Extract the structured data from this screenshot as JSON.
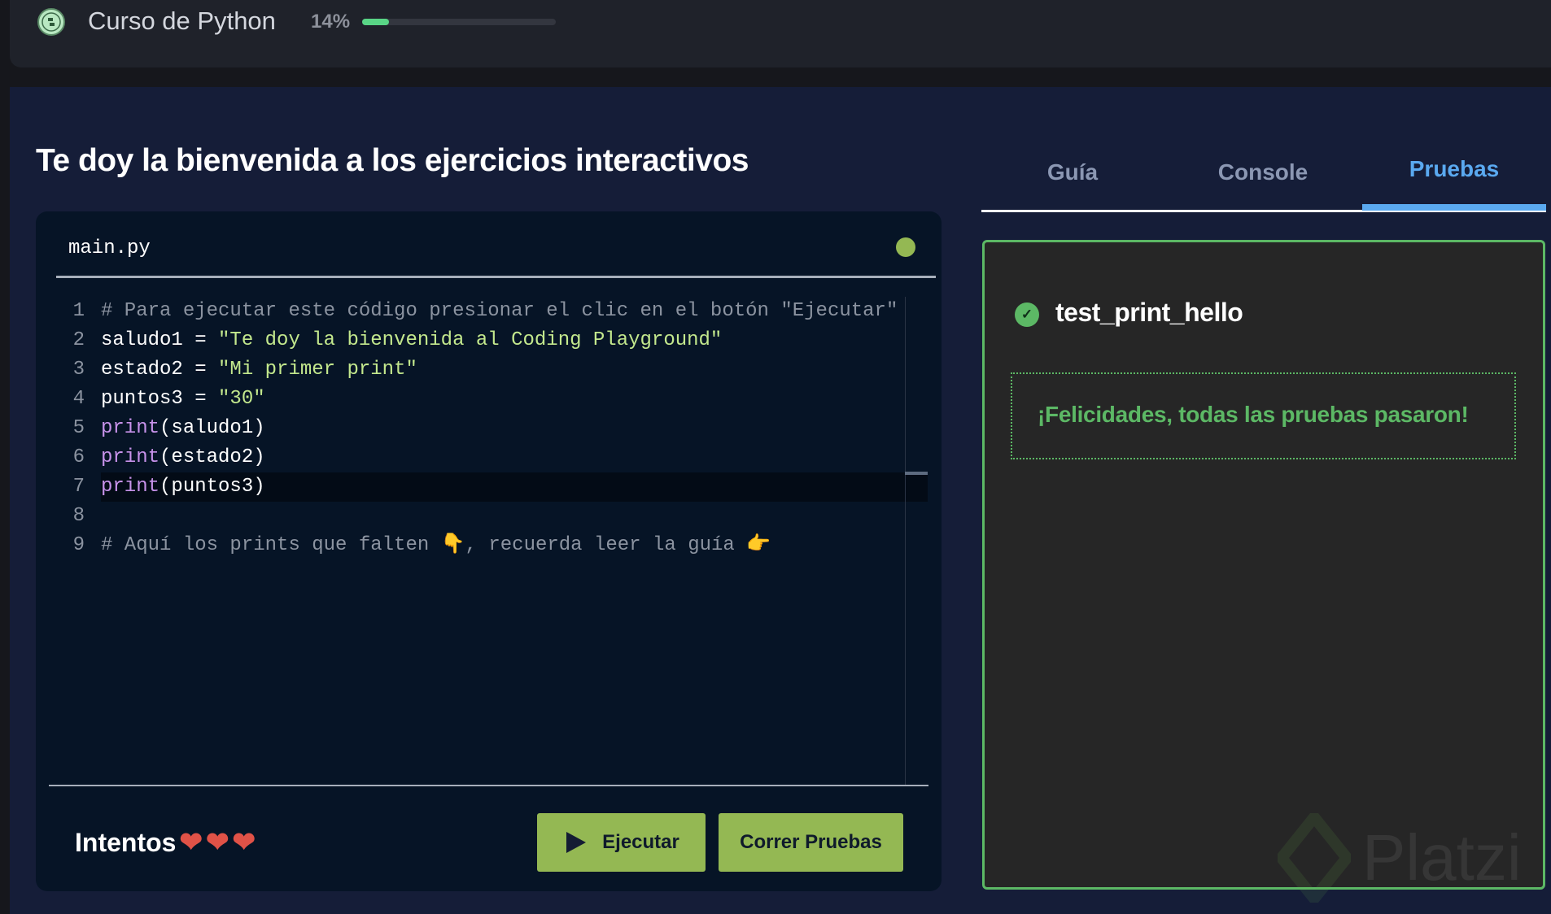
{
  "header": {
    "course_title": "Curso de Python",
    "progress_label": "14%",
    "progress_percent": 14,
    "logo_icon": "python-course-badge-icon"
  },
  "page_title": "Te doy la bienvenida a los ejercicios interactivos",
  "editor": {
    "filename": "main.py",
    "status_color": "#94b853",
    "lines": [
      {
        "n": "1",
        "parts": [
          {
            "t": "# Para ejecutar este código presionar el clic en el botón \"Ejecutar\"",
            "c": "cm"
          }
        ]
      },
      {
        "n": "2",
        "parts": [
          {
            "t": "saludo1 = ",
            "c": ""
          },
          {
            "t": "\"Te doy la bienvenida al Coding Playground\"",
            "c": "st"
          }
        ]
      },
      {
        "n": "3",
        "parts": [
          {
            "t": "estado2 = ",
            "c": ""
          },
          {
            "t": "\"Mi primer print\"",
            "c": "st"
          }
        ]
      },
      {
        "n": "4",
        "parts": [
          {
            "t": "puntos3 = ",
            "c": ""
          },
          {
            "t": "\"30\"",
            "c": "st"
          }
        ]
      },
      {
        "n": "5",
        "parts": [
          {
            "t": "print",
            "c": "kw"
          },
          {
            "t": "(saludo1)",
            "c": ""
          }
        ]
      },
      {
        "n": "6",
        "parts": [
          {
            "t": "print",
            "c": "kw"
          },
          {
            "t": "(estado2)",
            "c": ""
          }
        ]
      },
      {
        "n": "7",
        "parts": [
          {
            "t": "print",
            "c": "kw"
          },
          {
            "t": "(puntos3)",
            "c": ""
          }
        ]
      },
      {
        "n": "8",
        "parts": []
      },
      {
        "n": "9",
        "parts": [
          {
            "t": "# Aquí los prints que falten 👇, recuerda leer la guía 👉",
            "c": "cm"
          }
        ]
      }
    ],
    "current_line": 7
  },
  "footer": {
    "attempts_label": "Intentos",
    "hearts": [
      "❤",
      "❤",
      "❤"
    ],
    "run_label": "Ejecutar",
    "test_label": "Correr Pruebas"
  },
  "tabs": [
    {
      "label": "Guía"
    },
    {
      "label": "Console"
    },
    {
      "label": "Pruebas",
      "active": true
    }
  ],
  "tests": {
    "name": "test_print_hello",
    "status": "passed",
    "message": "¡Felicidades, todas las pruebas pasaron!"
  },
  "watermark": "Platzi",
  "colors": {
    "accent": "#94b853",
    "success": "#5cb865",
    "tab_active": "#5aa9f0"
  }
}
